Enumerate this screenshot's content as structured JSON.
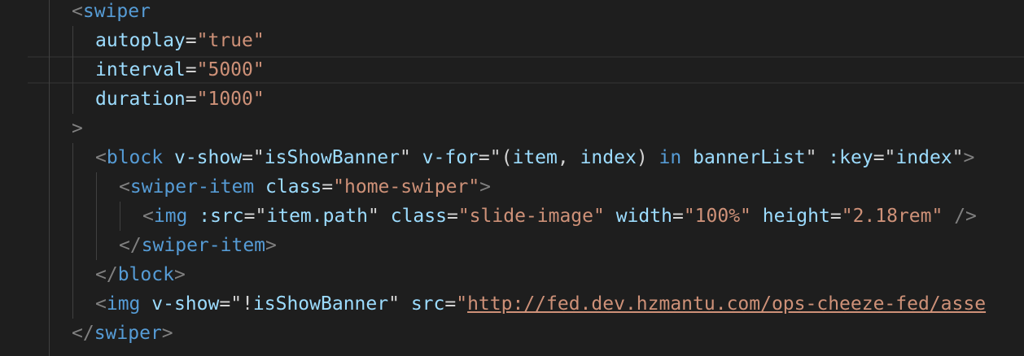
{
  "lines": [
    {
      "indent": 0,
      "tokens": [
        {
          "t": "<",
          "c": "punct"
        },
        {
          "t": "swiper",
          "c": "tag"
        }
      ]
    },
    {
      "indent": 1,
      "tokens": [
        {
          "t": "autoplay",
          "c": "attr"
        },
        {
          "t": "=",
          "c": "text"
        },
        {
          "t": "\"true\"",
          "c": "str"
        }
      ]
    },
    {
      "indent": 1,
      "current": true,
      "tokens": [
        {
          "t": "interval",
          "c": "attr"
        },
        {
          "t": "=",
          "c": "text"
        },
        {
          "t": "\"5000\"",
          "c": "str"
        }
      ]
    },
    {
      "indent": 1,
      "tokens": [
        {
          "t": "duration",
          "c": "attr"
        },
        {
          "t": "=",
          "c": "text"
        },
        {
          "t": "\"1000\"",
          "c": "str"
        }
      ]
    },
    {
      "indent": 0,
      "tokens": [
        {
          "t": ">",
          "c": "punct"
        }
      ]
    },
    {
      "indent": 1,
      "tokens": [
        {
          "t": "<",
          "c": "punct"
        },
        {
          "t": "block",
          "c": "tag"
        },
        {
          "t": " ",
          "c": "text"
        },
        {
          "t": "v-show",
          "c": "attr"
        },
        {
          "t": "=",
          "c": "text"
        },
        {
          "t": "\"",
          "c": "text"
        },
        {
          "t": "isShowBanner",
          "c": "attr"
        },
        {
          "t": "\"",
          "c": "text"
        },
        {
          "t": " ",
          "c": "text"
        },
        {
          "t": "v-for",
          "c": "attr"
        },
        {
          "t": "=",
          "c": "text"
        },
        {
          "t": "\"(",
          "c": "text"
        },
        {
          "t": "item",
          "c": "attr"
        },
        {
          "t": ", ",
          "c": "text"
        },
        {
          "t": "index",
          "c": "attr"
        },
        {
          "t": ") ",
          "c": "text"
        },
        {
          "t": "in",
          "c": "kw"
        },
        {
          "t": " ",
          "c": "text"
        },
        {
          "t": "bannerList",
          "c": "attr"
        },
        {
          "t": "\"",
          "c": "text"
        },
        {
          "t": " ",
          "c": "text"
        },
        {
          "t": ":key",
          "c": "attr"
        },
        {
          "t": "=",
          "c": "text"
        },
        {
          "t": "\"",
          "c": "text"
        },
        {
          "t": "index",
          "c": "attr"
        },
        {
          "t": "\"",
          "c": "text"
        },
        {
          "t": ">",
          "c": "punct"
        }
      ]
    },
    {
      "indent": 2,
      "tokens": [
        {
          "t": "<",
          "c": "punct"
        },
        {
          "t": "swiper-item",
          "c": "tag"
        },
        {
          "t": " ",
          "c": "text"
        },
        {
          "t": "class",
          "c": "attr"
        },
        {
          "t": "=",
          "c": "text"
        },
        {
          "t": "\"home-swiper\"",
          "c": "str"
        },
        {
          "t": ">",
          "c": "punct"
        }
      ]
    },
    {
      "indent": 3,
      "tokens": [
        {
          "t": "<",
          "c": "punct"
        },
        {
          "t": "img",
          "c": "tag"
        },
        {
          "t": " ",
          "c": "text"
        },
        {
          "t": ":src",
          "c": "attr"
        },
        {
          "t": "=",
          "c": "text"
        },
        {
          "t": "\"",
          "c": "text"
        },
        {
          "t": "item.path",
          "c": "attr"
        },
        {
          "t": "\"",
          "c": "text"
        },
        {
          "t": " ",
          "c": "text"
        },
        {
          "t": "class",
          "c": "attr"
        },
        {
          "t": "=",
          "c": "text"
        },
        {
          "t": "\"slide-image\"",
          "c": "str"
        },
        {
          "t": " ",
          "c": "text"
        },
        {
          "t": "width",
          "c": "attr"
        },
        {
          "t": "=",
          "c": "text"
        },
        {
          "t": "\"100%\"",
          "c": "str"
        },
        {
          "t": " ",
          "c": "text"
        },
        {
          "t": "height",
          "c": "attr"
        },
        {
          "t": "=",
          "c": "text"
        },
        {
          "t": "\"2.18rem\"",
          "c": "str"
        },
        {
          "t": " ",
          "c": "text"
        },
        {
          "t": "/>",
          "c": "punct"
        }
      ]
    },
    {
      "indent": 2,
      "tokens": [
        {
          "t": "</",
          "c": "punct"
        },
        {
          "t": "swiper-item",
          "c": "tag"
        },
        {
          "t": ">",
          "c": "punct"
        }
      ]
    },
    {
      "indent": 1,
      "tokens": [
        {
          "t": "</",
          "c": "punct"
        },
        {
          "t": "block",
          "c": "tag"
        },
        {
          "t": ">",
          "c": "punct"
        }
      ]
    },
    {
      "indent": 1,
      "tokens": [
        {
          "t": "<",
          "c": "punct"
        },
        {
          "t": "img",
          "c": "tag"
        },
        {
          "t": " ",
          "c": "text"
        },
        {
          "t": "v-show",
          "c": "attr"
        },
        {
          "t": "=",
          "c": "text"
        },
        {
          "t": "\"!",
          "c": "text"
        },
        {
          "t": "isShowBanner",
          "c": "attr"
        },
        {
          "t": "\"",
          "c": "text"
        },
        {
          "t": " ",
          "c": "text"
        },
        {
          "t": "src",
          "c": "attr"
        },
        {
          "t": "=",
          "c": "text"
        },
        {
          "t": "\"",
          "c": "str"
        },
        {
          "t": "http://fed.dev.hzmantu.com/ops-cheeze-fed/asse",
          "c": "link"
        }
      ]
    },
    {
      "indent": 0,
      "tokens": [
        {
          "t": "</",
          "c": "punct"
        },
        {
          "t": "swiper",
          "c": "tag"
        },
        {
          "t": ">",
          "c": "punct"
        }
      ]
    }
  ]
}
